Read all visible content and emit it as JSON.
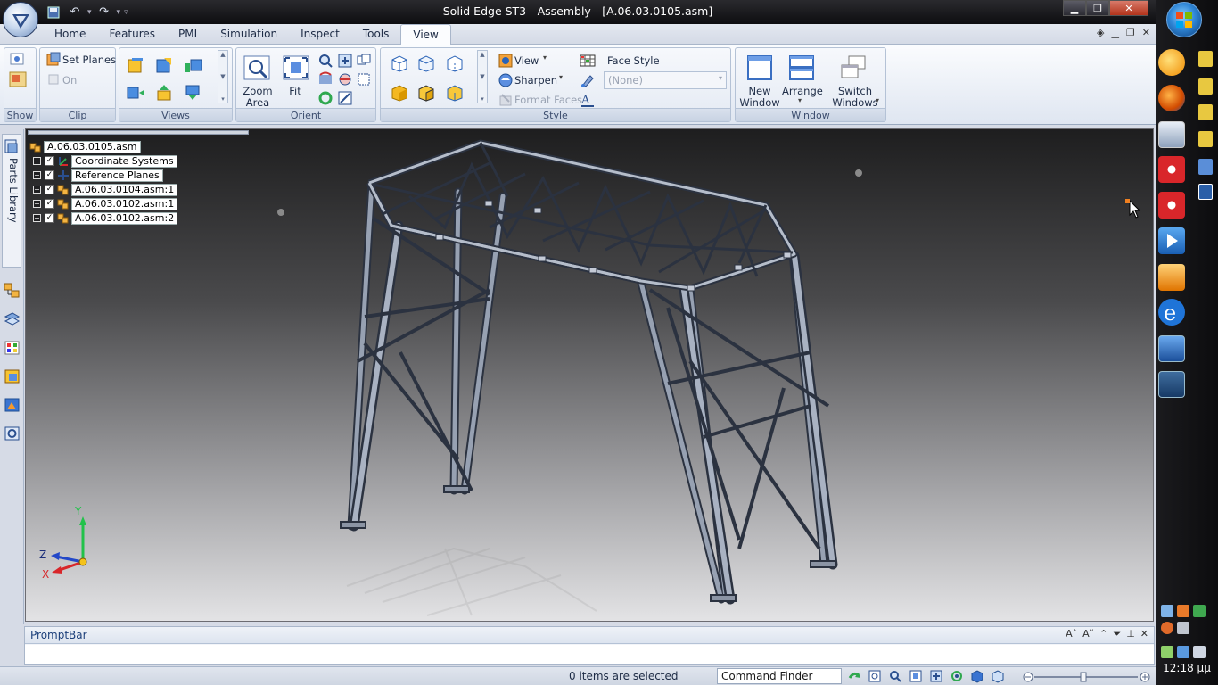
{
  "window": {
    "title": "Solid Edge ST3 - Assembly - [A.06.03.0105.asm]"
  },
  "colors": {
    "ribbon_accent": "#3b5f9a",
    "viewport_top": "#1e1e1f",
    "viewport_bottom": "#e3e3e5",
    "axis_y": "#22c24a",
    "axis_x": "#d8262a",
    "axis_z": "#2348c8"
  },
  "tabs": [
    "Home",
    "Features",
    "PMI",
    "Simulation",
    "Inspect",
    "Tools",
    "View"
  ],
  "active_tab": "View",
  "ribbon": {
    "show": {
      "label": "Show"
    },
    "clip": {
      "label": "Clip",
      "set_planes": "Set Planes",
      "on": "On"
    },
    "views": {
      "label": "Views"
    },
    "orient": {
      "label": "Orient",
      "zoom_area": "Zoom Area",
      "fit": "Fit"
    },
    "style": {
      "label": "Style",
      "view": "View",
      "sharpen": "Sharpen",
      "format_faces": "Format Faces",
      "face_style": "Face Style",
      "face_style_value": "(None)"
    },
    "window": {
      "label": "Window",
      "new_window": "New Window",
      "arrange": "Arrange",
      "switch_windows": "Switch Windows"
    }
  },
  "left_strip": {
    "parts_library": "Parts Library"
  },
  "tree": {
    "root": "A.06.03.0105.asm",
    "items": [
      {
        "label": "Coordinate Systems",
        "icon": "coordinate-system-icon"
      },
      {
        "label": "Reference Planes",
        "icon": "reference-plane-icon"
      },
      {
        "label": "A.06.03.0104.asm:1",
        "icon": "subassembly-icon"
      },
      {
        "label": "A.06.03.0102.asm:1",
        "icon": "subassembly-icon"
      },
      {
        "label": "A.06.03.0102.asm:2",
        "icon": "subassembly-icon"
      }
    ]
  },
  "axes": {
    "x": "X",
    "y": "Y",
    "z": "Z"
  },
  "promptbar": {
    "title": "PromptBar",
    "text": ""
  },
  "status": {
    "selected": "0 items are selected",
    "command_finder": "Command Finder"
  },
  "clock": "12:18 μμ"
}
